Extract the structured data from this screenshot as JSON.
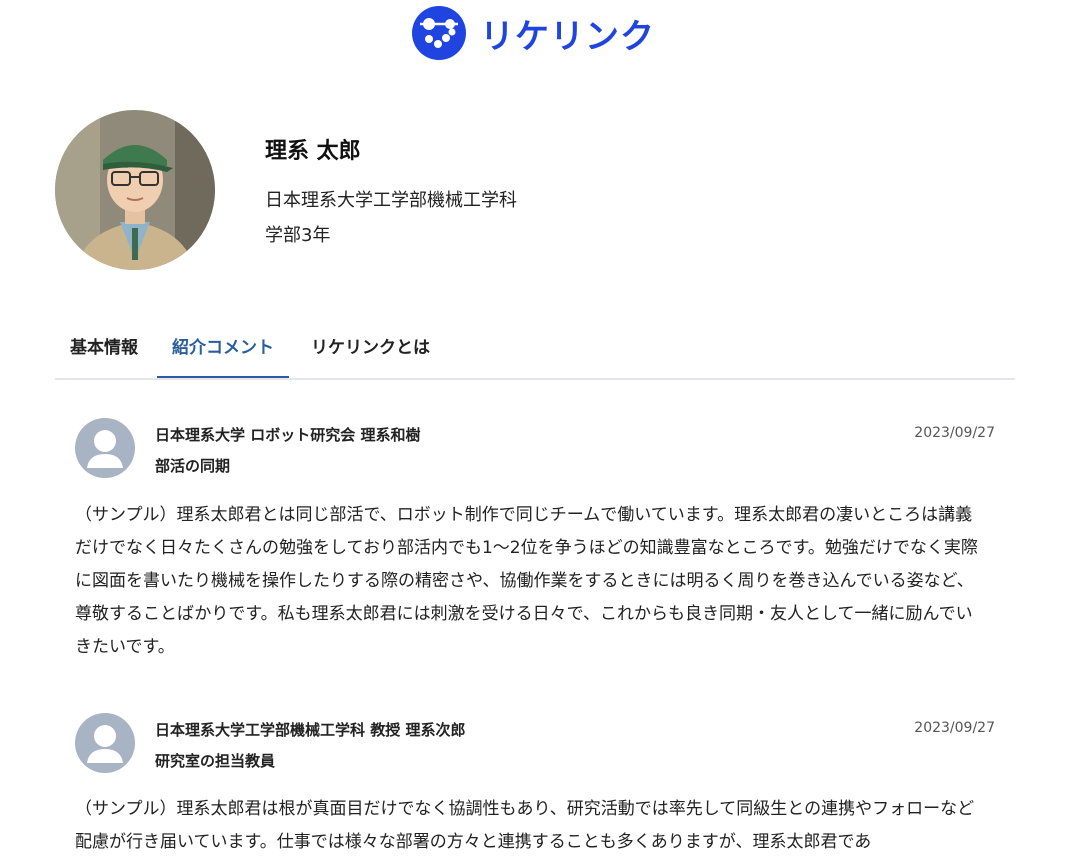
{
  "header": {
    "logo_text": "リケリンク"
  },
  "profile": {
    "name": "理系 太郎",
    "affiliation": "日本理系大学工学部機械工学科",
    "year": "学部3年"
  },
  "tabs": [
    {
      "label": "基本情報"
    },
    {
      "label": "紹介コメント"
    },
    {
      "label": "リケリンクとは"
    }
  ],
  "comments": [
    {
      "author": "日本理系大学 ロボット研究会 理系和樹",
      "relation": "部活の同期",
      "date": "2023/09/27",
      "body": "（サンプル）理系太郎君とは同じ部活で、ロボット制作で同じチームで働いています。理系太郎君の凄いところは講義だけでなく日々たくさんの勉強をしており部活内でも1〜2位を争うほどの知識豊富なところです。勉強だけでなく実際に図面を書いたり機械を操作したりする際の精密さや、協働作業をするときには明るく周りを巻き込んでいる姿など、尊敬することばかりです。私も理系太郎君には刺激を受ける日々で、これからも良き同期・友人として一緒に励んでいきたいです。"
    },
    {
      "author": "日本理系大学工学部機械工学科 教授 理系次郎",
      "relation": "研究室の担当教員",
      "date": "2023/09/27",
      "body": "（サンプル）理系太郎君は根が真面目だけでなく協調性もあり、研究活動では率先して同級生との連携やフォローなど配慮が行き届いています。仕事では様々な部署の方々と連携することも多くありますが、理系太郎君であ"
    }
  ],
  "colors": {
    "brand": "#1f44e0",
    "tab_active": "#2a5d9c",
    "avatar_placeholder": "#a8b3c4"
  },
  "icons": {
    "logo": "molecule-logo-icon",
    "default_avatar": "user-silhouette-icon"
  }
}
